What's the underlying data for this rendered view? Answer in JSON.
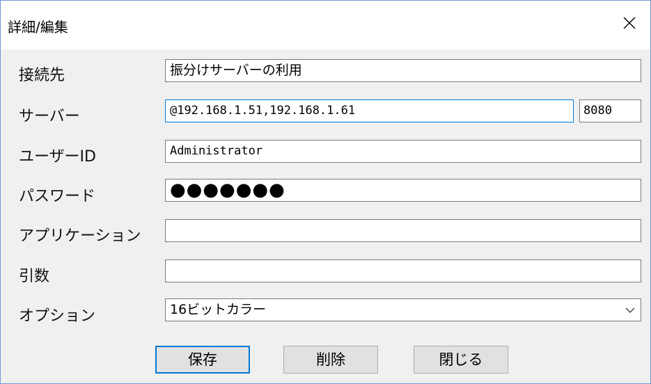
{
  "window": {
    "title": "詳細/編集"
  },
  "labels": {
    "connection": "接続先",
    "server": "サーバー",
    "user_id": "ユーザーID",
    "password": "パスワード",
    "application": "アプリケーション",
    "arguments": "引数",
    "options": "オプション"
  },
  "fields": {
    "connection": "振分けサーバーの利用",
    "server": "@192.168.1.51,192.168.1.61",
    "port": "8080",
    "user_id": "Administrator",
    "password_mask": "●●●●●●●",
    "application": "",
    "arguments": "",
    "options_selected": "16ビットカラー"
  },
  "buttons": {
    "save": "保存",
    "delete": "削除",
    "close": "閉じる"
  },
  "icons": {
    "close": "close-icon",
    "dropdown": "chevron-down-icon"
  },
  "colors": {
    "focus_border": "#0078d7",
    "dialog_bg": "#f0f0f0"
  }
}
